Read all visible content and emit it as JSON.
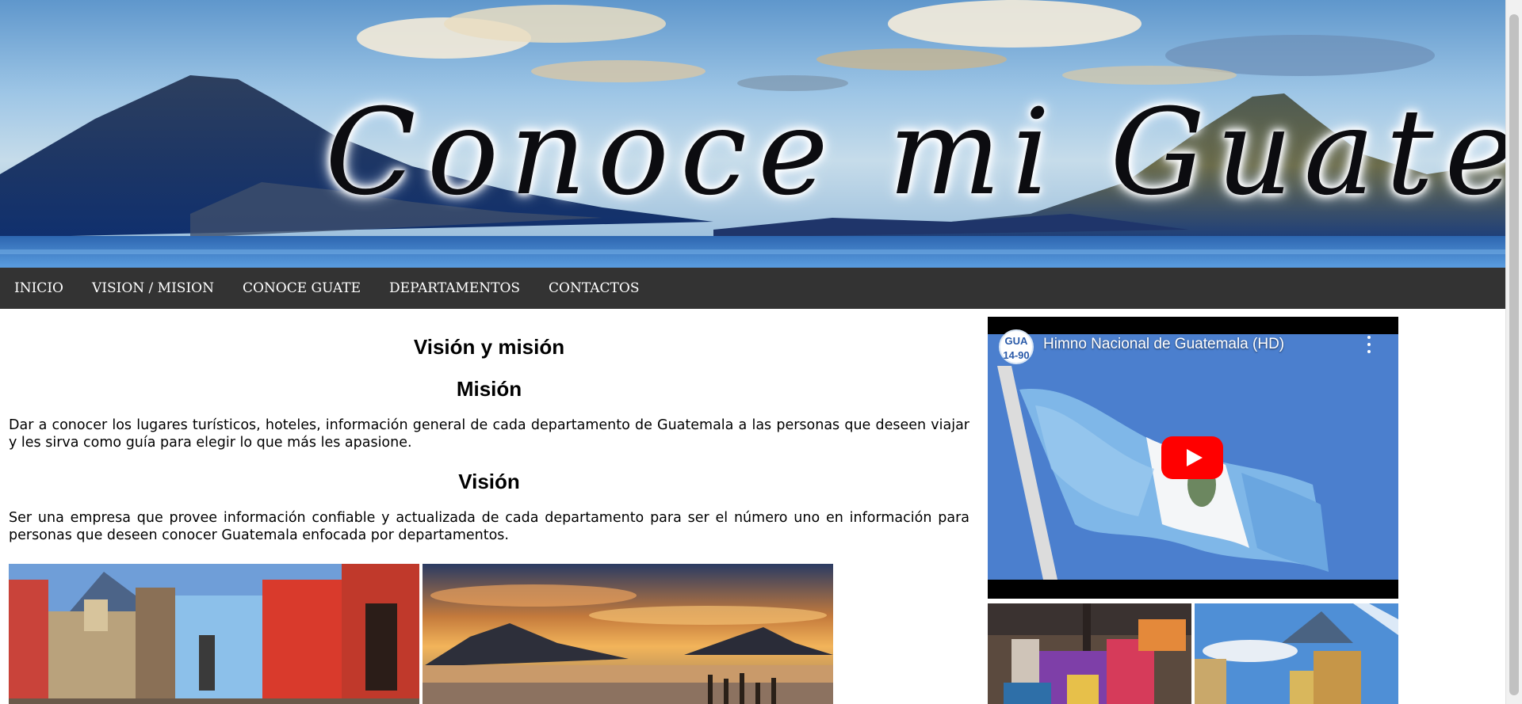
{
  "header": {
    "site_title": "Conoce mi Guate"
  },
  "nav": {
    "items": [
      {
        "label": "INICIO"
      },
      {
        "label": "VISION / MISION"
      },
      {
        "label": "CONOCE GUATE"
      },
      {
        "label": "DEPARTAMENTOS"
      },
      {
        "label": "CONTACTOS"
      }
    ]
  },
  "main": {
    "title": "Visión y misión",
    "mision_heading": "Misión",
    "mision_text": "Dar a conocer los lugares turísticos, hoteles, información general de cada departamento de Guatemala a las personas que deseen viajar y les sirva como guía para elegir lo que más les apasione.",
    "vision_heading": "Visión",
    "vision_text": "Ser una empresa que provee información confiable y actualizada de cada departamento para ser el número uno en información para personas que deseen conocer Guatemala enfocada por departamentos."
  },
  "video": {
    "title": "Himno Nacional de Guatemala (HD)",
    "channel_badge": "GUA 14-90",
    "play_icon": "play-icon",
    "menu_icon": "more-vert-icon"
  },
  "colors": {
    "nav_bg": "#333333",
    "nav_text": "#ffffff",
    "play_button": "#ff0000",
    "flag_blue": "#7fb7e8"
  }
}
